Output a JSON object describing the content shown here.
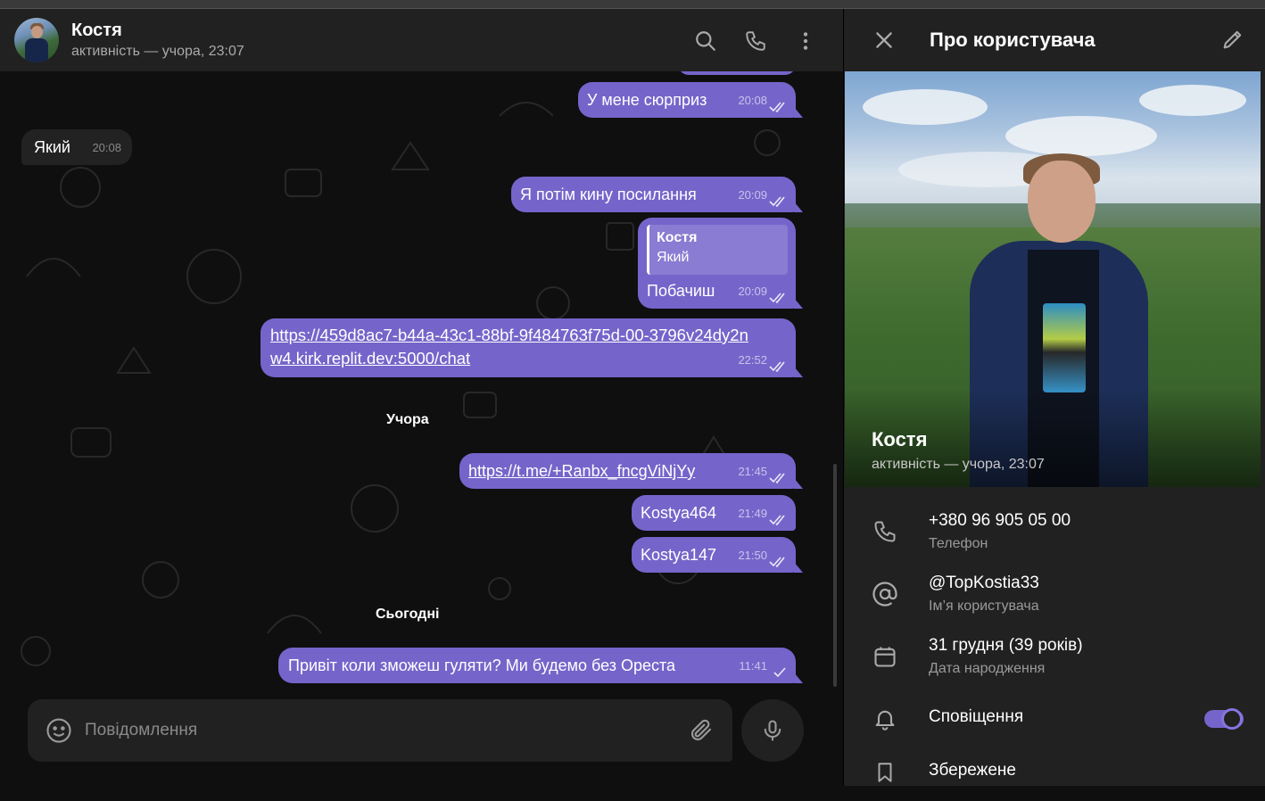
{
  "header": {
    "title": "Костя",
    "status": "активність — учора, 23:07"
  },
  "messages": [
    {
      "id": "m1",
      "text": "У мене сюрприз",
      "time": "20:08",
      "direction": "out"
    },
    {
      "id": "m2",
      "text": "Який",
      "time": "20:08",
      "direction": "in"
    },
    {
      "id": "m3",
      "text": "Я потім кину посилання",
      "time": "20:09",
      "direction": "out"
    },
    {
      "id": "m4",
      "text": "Побачиш",
      "time": "20:09",
      "direction": "out",
      "reply_name": "Костя",
      "reply_text": "Який"
    },
    {
      "id": "m5",
      "text_line1": "https://459d8ac7-b44a-43c1-88bf-9f484763f75d-00-3796v24dy2n",
      "text_line2": "w4.kirk.replit.dev:5000/chat",
      "time": "22:52",
      "direction": "out"
    },
    {
      "id": "m6",
      "text": "https://t.me/+Ranbx_fncgViNjYy",
      "time": "21:45",
      "direction": "out"
    },
    {
      "id": "m7",
      "text": "Kostya464",
      "time": "21:49",
      "direction": "out"
    },
    {
      "id": "m8",
      "text": "Kostya147",
      "time": "21:50",
      "direction": "out"
    },
    {
      "id": "m9",
      "text": "Привіт коли зможеш гуляти? Ми будемо без Ореста",
      "time": "11:41",
      "direction": "out"
    }
  ],
  "days": {
    "yesterday": "Учора",
    "today": "Сьогодні"
  },
  "composer": {
    "placeholder": "Повідомлення"
  },
  "panel": {
    "title": "Про користувача",
    "name": "Костя",
    "status": "активність — учора, 23:07",
    "phone": "+380 96 905 05 00",
    "phone_label": "Телефон",
    "username": "@TopKostia33",
    "username_label": "Ім’я користувача",
    "birthday": "31 грудня (39 років)",
    "birthday_label": "Дата народження",
    "notifications": "Сповіщення",
    "notifications_on": true,
    "saved": "Збережене"
  },
  "colors": {
    "accent": "#7565ca",
    "panel_bg": "#212121",
    "chat_bg": "#0f0f10"
  },
  "icons": [
    "search-icon",
    "phone-icon",
    "more-icon",
    "close-icon",
    "edit-icon",
    "emoji-icon",
    "attach-icon",
    "mic-icon",
    "at-icon",
    "calendar-icon",
    "bell-icon",
    "bookmark-icon",
    "double-check-icon",
    "single-check-icon"
  ]
}
